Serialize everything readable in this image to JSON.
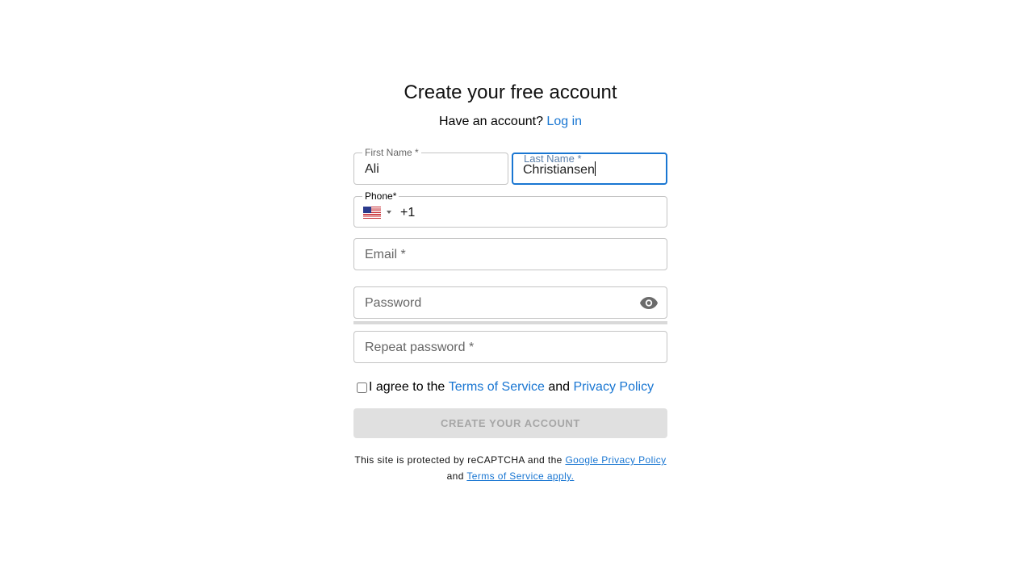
{
  "header": {
    "title": "Create your free account",
    "have_account": "Have an account?",
    "login_link": "Log in"
  },
  "form": {
    "first_name": {
      "label": "First Name *",
      "value": "Ali"
    },
    "last_name": {
      "label": "Last Name *",
      "value": "Christiansen"
    },
    "phone": {
      "label": "Phone*",
      "country_flag": "us-flag-icon",
      "dial_code": "+1"
    },
    "email": {
      "placeholder": "Email *",
      "value": ""
    },
    "password": {
      "placeholder": "Password",
      "value": "",
      "toggle_icon": "eye-icon"
    },
    "repeat_password": {
      "placeholder": "Repeat password *",
      "value": ""
    }
  },
  "agree": {
    "prefix": "I agree to the",
    "terms_link": "Terms of Service",
    "and": "and",
    "privacy_link": "Privacy Policy",
    "checked": false
  },
  "submit": {
    "label": "CREATE YOUR ACCOUNT",
    "enabled": false
  },
  "recaptcha": {
    "line1_prefix": "This site is protected by reCAPTCHA and the",
    "privacy_link": "Google Privacy Policy",
    "line2_prefix": "and",
    "terms_link": "Terms of Service apply."
  },
  "colors": {
    "accent": "#1976d2",
    "border": "#c4c4c4",
    "button_disabled_bg": "#e0e0e0",
    "button_disabled_text": "#a6a6a6"
  }
}
